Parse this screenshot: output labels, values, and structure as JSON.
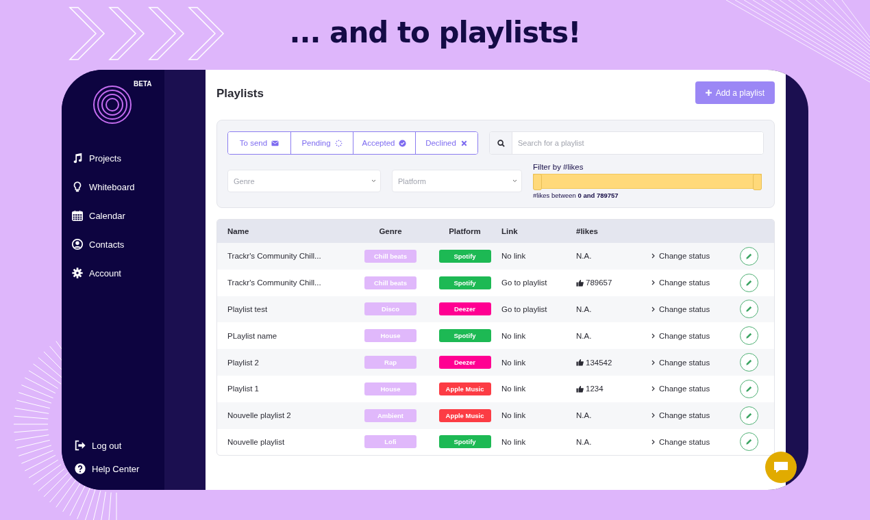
{
  "banner": {
    "headline": "... and to playlists!"
  },
  "sidebar": {
    "badge": "BETA",
    "items": [
      {
        "label": "Projects",
        "kind": "music"
      },
      {
        "label": "Whiteboard",
        "kind": "bulb"
      },
      {
        "label": "Calendar",
        "kind": "calendar"
      },
      {
        "label": "Contacts",
        "kind": "user"
      },
      {
        "label": "Account",
        "kind": "gear"
      }
    ],
    "footer_items": [
      {
        "label": "Log out",
        "kind": "logout"
      },
      {
        "label": "Help Center",
        "kind": "help"
      }
    ]
  },
  "page": {
    "title": "Playlists",
    "add_button": "Add a playlist"
  },
  "filters": {
    "statuses": [
      {
        "label": "To send",
        "kind": "send"
      },
      {
        "label": "Pending",
        "kind": "pending"
      },
      {
        "label": "Accepted",
        "kind": "accepted"
      },
      {
        "label": "Declined",
        "kind": "declined"
      }
    ],
    "search": {
      "placeholder": "Search for a playlist"
    },
    "genre": {
      "placeholder": "Genre"
    },
    "platform": {
      "placeholder": "Platform"
    },
    "likes_filter": {
      "label": "Filter by #likes",
      "level": 1,
      "caption": "#likes between **0 and 789757**"
    }
  },
  "table": {
    "columns": [
      "Name",
      "Genre",
      "Platform",
      "Link",
      "#likes"
    ],
    "rows": [
      {
        "name": "Trackr's Community Chill...",
        "genre": "Chill beats",
        "platform": {
          "label": "Spotify",
          "color": "#1db954"
        },
        "link": "No link",
        "likes": "N.A.",
        "thumbs_up": false,
        "action": "Change status"
      },
      {
        "name": "Trackr's Community Chill...",
        "genre": "Chill beats",
        "platform": {
          "label": "Spotify",
          "color": "#1db954"
        },
        "link": "Go to playlist",
        "likes": "789657",
        "thumbs_up": true,
        "action": "Change status"
      },
      {
        "name": "Playlist test",
        "genre": "Disco",
        "platform": {
          "label": "Deezer",
          "color": "#ff0092"
        },
        "link": "Go to playlist",
        "likes": "N.A.",
        "thumbs_up": false,
        "action": "Change status"
      },
      {
        "name": "PLaylist name",
        "genre": "House",
        "platform": {
          "label": "Spotify",
          "color": "#1db954"
        },
        "link": "No link",
        "likes": "N.A.",
        "thumbs_up": false,
        "action": "Change status"
      },
      {
        "name": "Playlist 2",
        "genre": "Rap",
        "platform": {
          "label": "Deezer",
          "color": "#ff0092"
        },
        "link": "No link",
        "likes": "134542",
        "thumbs_up": true,
        "action": "Change status"
      },
      {
        "name": "Playlist 1",
        "genre": "House",
        "platform": {
          "label": "Apple Music",
          "color": "#fc3c44"
        },
        "link": "No link",
        "likes": "1234",
        "thumbs_up": true,
        "action": "Change status"
      },
      {
        "name": "Nouvelle playlist 2",
        "genre": "Ambient",
        "platform": {
          "label": "Apple Music",
          "color": "#fc3c44"
        },
        "link": "No link",
        "likes": "N.A.",
        "thumbs_up": false,
        "action": "Change status"
      },
      {
        "name": "Nouvelle playlist",
        "genre": "Lofi",
        "platform": {
          "label": "Spotify",
          "color": "#1db954"
        },
        "link": "No link",
        "likes": "N.A.",
        "thumbs_up": false,
        "action": "Change status"
      }
    ]
  }
}
